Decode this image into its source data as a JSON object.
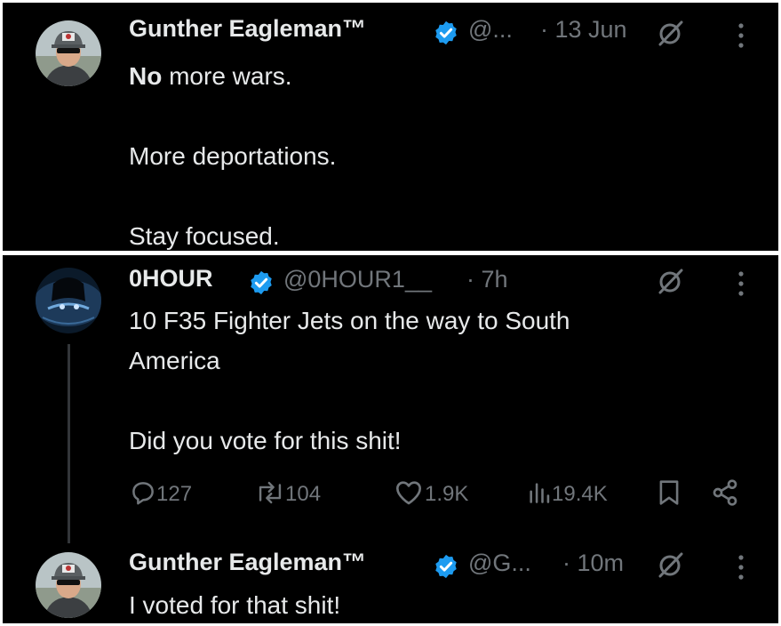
{
  "tweet_top": {
    "display_name": "Gunther Eagleman™",
    "handle": "@...",
    "time": "· 13 Jun",
    "text_bold": "No",
    "text_rest": " more wars.\n\nMore deportations.\n\nStay focused."
  },
  "tweet_middle": {
    "display_name": "0HOUR",
    "handle": "@0HOUR1__",
    "time": "· 7h",
    "text": "10 F35 Fighter Jets on the way to South\nAmerica\n\nDid you vote for this shit!",
    "stats": {
      "replies": "127",
      "reposts": "104",
      "likes": "1.9K",
      "views": "19.4K"
    }
  },
  "tweet_bottom": {
    "display_name": "Gunther Eagleman™",
    "handle": "@G...",
    "time": "· 10m",
    "text": "I voted for that shit!"
  },
  "colors": {
    "background": "#000000",
    "text": "#e7e9ea",
    "muted": "#71767b",
    "verified": "#1d9bf0"
  }
}
